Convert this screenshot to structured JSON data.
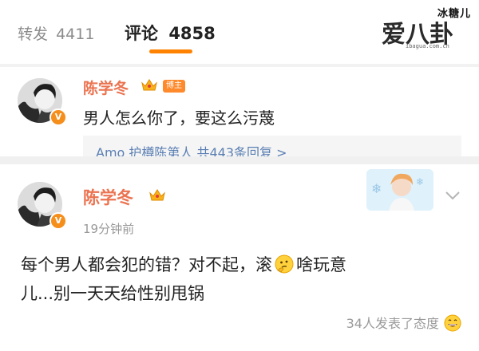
{
  "tabs": {
    "repost_label": "转发",
    "repost_count": "4411",
    "comment_label": "评论",
    "comment_count": "4858"
  },
  "watermark": {
    "brand": "爱八卦",
    "corner_text": "冰糖儿",
    "url": "ibagua.com.cn"
  },
  "comments": [
    {
      "username": "陈学冬",
      "badge": "博主",
      "verified": true,
      "text": "男人怎么你了，要这么污蔑",
      "reply_preview": "Amo 护樽陈第人 共443条回复 >"
    },
    {
      "username": "陈学冬",
      "verified": true,
      "time": "19分钟前",
      "text_part1": "每个男人都会犯的错？对不起，滚",
      "text_part2": "啥玩意",
      "text_line2": "儿...别一天天给性别甩锅",
      "reaction_text": "34人发表了态度"
    }
  ],
  "icons": {
    "crown": "crown-icon",
    "verified": "verified-v-icon",
    "thinking_emoji": "thinking-face-emoji",
    "laugh_emoji": "grinning-face-emoji",
    "chevron": "chevron-down-icon"
  },
  "colors": {
    "accent_orange": "#ff8200",
    "username": "#eb7350",
    "link_blue": "#5b7fb3",
    "muted": "#999999"
  }
}
